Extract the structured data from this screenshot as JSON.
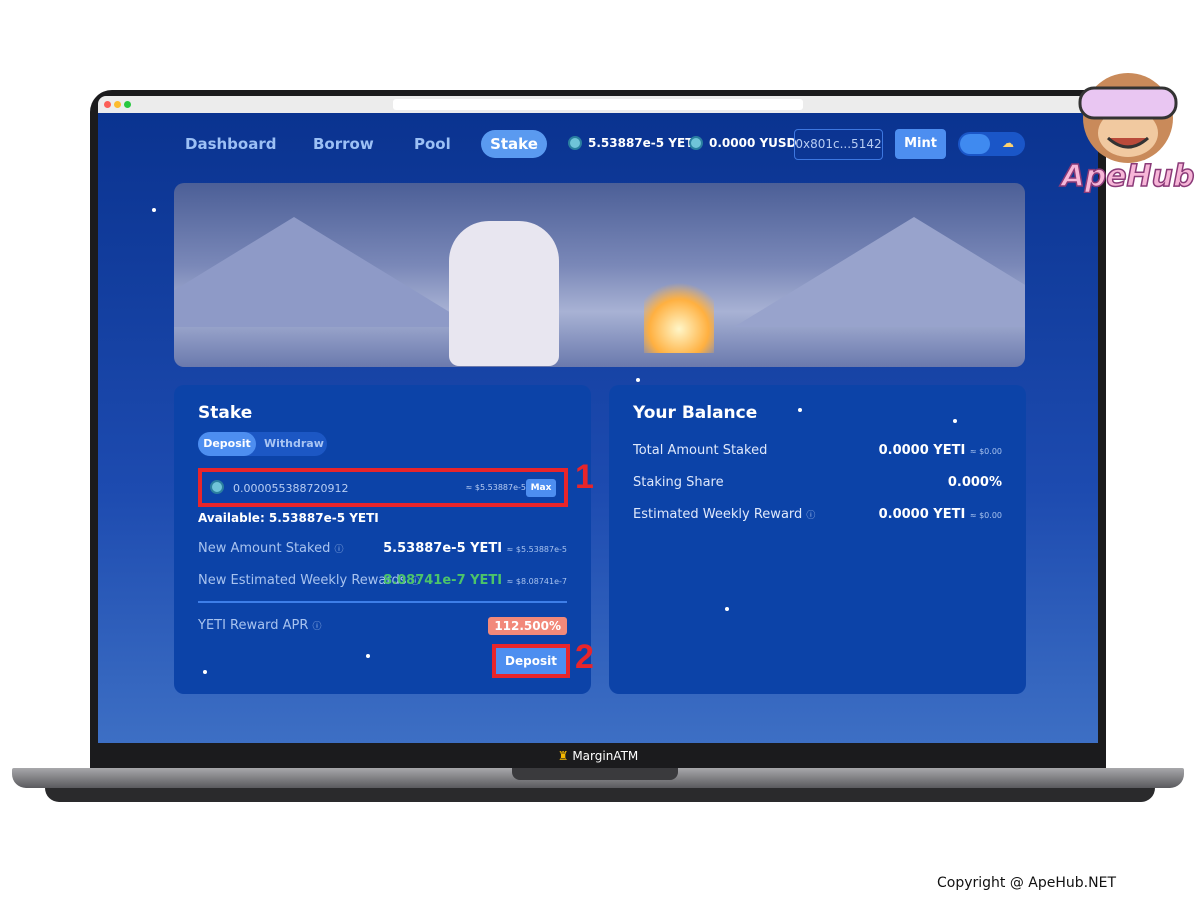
{
  "nav": {
    "items": [
      "Dashboard",
      "Borrow",
      "Pool",
      "Stake"
    ],
    "active": "Stake",
    "yeti_balance": "5.53887e-5 YETI",
    "yusd_balance": "0.0000 YUSD",
    "address": "0x801c...5142",
    "mint_label": "Mint"
  },
  "stake": {
    "title": "Stake",
    "tabs": [
      "Deposit",
      "Withdraw"
    ],
    "input_value": "0.000055388720912",
    "input_usd": "≈ $5.53887e-5",
    "max_label": "Max",
    "available": "Available: 5.53887e-5 YETI",
    "rows": [
      {
        "label": "New Amount Staked",
        "value": "5.53887e-5 YETI",
        "usd": "≈ $5.53887e-5"
      },
      {
        "label": "New Estimated Weekly Rewards",
        "value": "8.08741e-7 YETI",
        "usd": "≈ $8.08741e-7"
      }
    ],
    "apr_label": "YETI Reward APR",
    "apr_value": "112.500%",
    "deposit_label": "Deposit"
  },
  "balance": {
    "title": "Your Balance",
    "rows": [
      {
        "label": "Total Amount Staked",
        "value": "0.0000 YETI",
        "usd": "≈ $0.00"
      },
      {
        "label": "Staking Share",
        "value": "0.000%",
        "usd": ""
      },
      {
        "label": "Estimated Weekly Reward",
        "value": "0.0000 YETI",
        "usd": "≈ $0.00"
      }
    ]
  },
  "annotations": [
    "1",
    "2"
  ],
  "footer_app": "MarginATM",
  "watermark": "ApeHub",
  "copyright": "Copyright @ ApeHub.NET",
  "colors": {
    "accent": "#4d8ef0",
    "green": "#4cc46a",
    "highlight": "#e8252b",
    "apr": "#f2897a"
  }
}
